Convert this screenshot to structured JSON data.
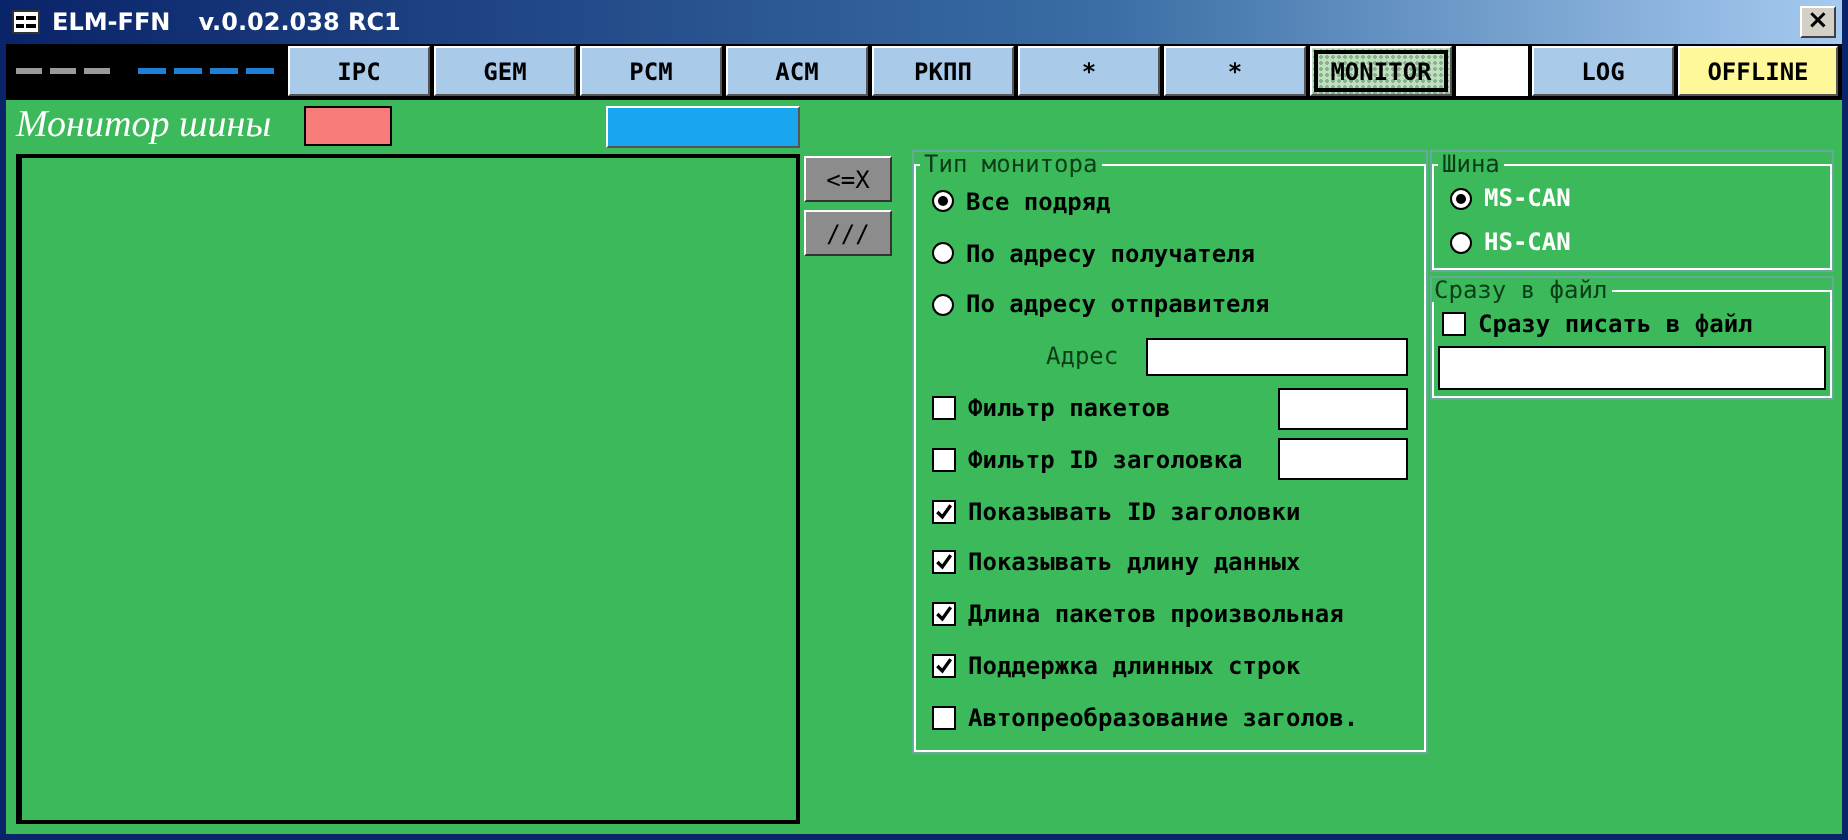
{
  "window": {
    "title": "ELM-FFN",
    "version": "v.0.02.038 RC1",
    "close": "×"
  },
  "tabs": [
    {
      "label": "IPC",
      "kind": "tab",
      "selected": false
    },
    {
      "label": "GEM",
      "kind": "tab",
      "selected": false
    },
    {
      "label": "PCM",
      "kind": "tab",
      "selected": false
    },
    {
      "label": "ACM",
      "kind": "tab",
      "selected": false
    },
    {
      "label": "РКПП",
      "kind": "tab",
      "selected": false
    },
    {
      "label": "*",
      "kind": "tab",
      "selected": false
    },
    {
      "label": "*",
      "kind": "tab",
      "selected": false
    },
    {
      "label": "MONITOR",
      "kind": "tab",
      "selected": true
    },
    {
      "kind": "gap"
    },
    {
      "label": "LOG",
      "kind": "tab",
      "selected": false
    },
    {
      "label": "OFFLINE",
      "kind": "status"
    }
  ],
  "monitor": {
    "title": "Монитор шины",
    "side_buttons": [
      "<=X",
      "///"
    ]
  },
  "monitor_type": {
    "legend": "Тип монитора",
    "rows": [
      {
        "kind": "radio",
        "label": "Все подряд",
        "selected": true
      },
      {
        "kind": "radio",
        "label": "По адресу получателя",
        "selected": false
      },
      {
        "kind": "radio",
        "label": "По адресу отправителя",
        "selected": false
      },
      {
        "kind": "field",
        "label": "Адрес"
      },
      {
        "kind": "checkbox_field",
        "label": "Фильтр пакетов",
        "checked": false
      },
      {
        "kind": "checkbox_field",
        "label": "Фильтр ID заголовка",
        "checked": false
      },
      {
        "kind": "checkbox",
        "label": "Показывать ID заголовки",
        "checked": true
      },
      {
        "kind": "checkbox",
        "label": "Показывать длину данных",
        "checked": true
      },
      {
        "kind": "checkbox",
        "label": "Длина пакетов произвольная",
        "checked": true
      },
      {
        "kind": "checkbox",
        "label": "Поддержка длинных строк",
        "checked": true
      },
      {
        "kind": "checkbox",
        "label": "Автопреобразование заголов.",
        "checked": false
      }
    ]
  },
  "bus": {
    "legend": "Шина",
    "options": [
      {
        "label": "MS-CAN",
        "selected": true
      },
      {
        "label": "HS-CAN",
        "selected": false
      }
    ]
  },
  "to_file": {
    "legend": "Сразу в файл",
    "checkbox": {
      "label": "Сразу писать в файл",
      "checked": false
    }
  }
}
